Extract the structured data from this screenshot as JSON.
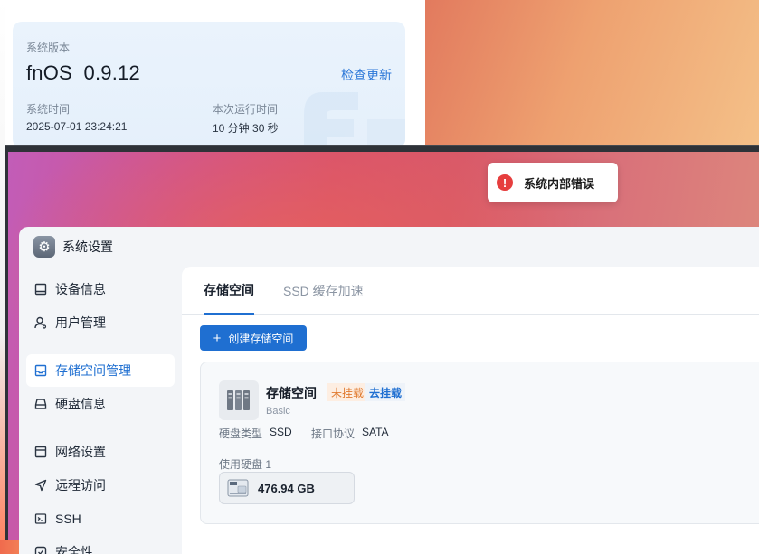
{
  "system_card": {
    "version_label": "系统版本",
    "version_value": "fnOS  0.9.12",
    "check_update": "检查更新",
    "time_label": "系统时间",
    "time_value": "2025-07-01 23:24:21",
    "uptime_label": "本次运行时间",
    "uptime_value": "10 分钟 30 秒"
  },
  "toast": {
    "icon": "error-icon",
    "message": "系统内部错误"
  },
  "app": {
    "title": "系统设置",
    "icon": "gear-icon"
  },
  "sidebar": {
    "items": [
      {
        "label": "设备信息",
        "icon": "device-icon",
        "active": false
      },
      {
        "label": "用户管理",
        "icon": "user-icon",
        "active": false
      },
      {
        "label": "存储空间管理",
        "icon": "storage-icon",
        "active": true
      },
      {
        "label": "硬盘信息",
        "icon": "disk-icon",
        "active": false
      },
      {
        "label": "网络设置",
        "icon": "network-icon",
        "active": false
      },
      {
        "label": "远程访问",
        "icon": "remote-icon",
        "active": false
      },
      {
        "label": "SSH",
        "icon": "terminal-icon",
        "active": false
      },
      {
        "label": "安全性",
        "icon": "shield-icon",
        "active": false
      }
    ]
  },
  "tabs": [
    {
      "label": "存储空间",
      "active": true
    },
    {
      "label": "SSD 缓存加速",
      "active": false
    }
  ],
  "create_button": "创建存储空间",
  "pool": {
    "name": "存储空间",
    "status_tag": "未挂载",
    "mount_action": "去挂载",
    "level": "Basic",
    "disk_type_label": "硬盘类型",
    "disk_type_value": "SSD",
    "interface_label": "接口协议",
    "interface_value": "SATA",
    "used_disks_label": "使用硬盘 1",
    "disk_size": "476.94 GB"
  },
  "colors": {
    "accent": "#1f6fd1",
    "error": "#e63e3e",
    "warning_tag": "#e07a2f"
  }
}
